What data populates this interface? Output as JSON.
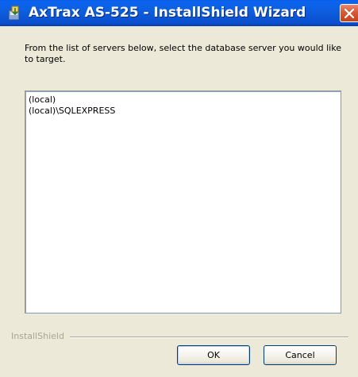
{
  "window": {
    "title": "AxTrax AS-525 - InstallShield Wizard",
    "icon": "installer-icon",
    "close_icon": "close-icon"
  },
  "instruction": "From the list of servers below, select the database server you would like to target.",
  "servers": [
    "(local)",
    "(local)\\SQLEXPRESS"
  ],
  "footer": {
    "brand": "InstallShield"
  },
  "buttons": {
    "ok_label": "OK",
    "cancel_label": "Cancel"
  },
  "colors": {
    "titlebar": "#0b5fe6",
    "window_background": "#ece9d8",
    "close_button": "#d45a35",
    "list_border": "#7f9db9"
  }
}
